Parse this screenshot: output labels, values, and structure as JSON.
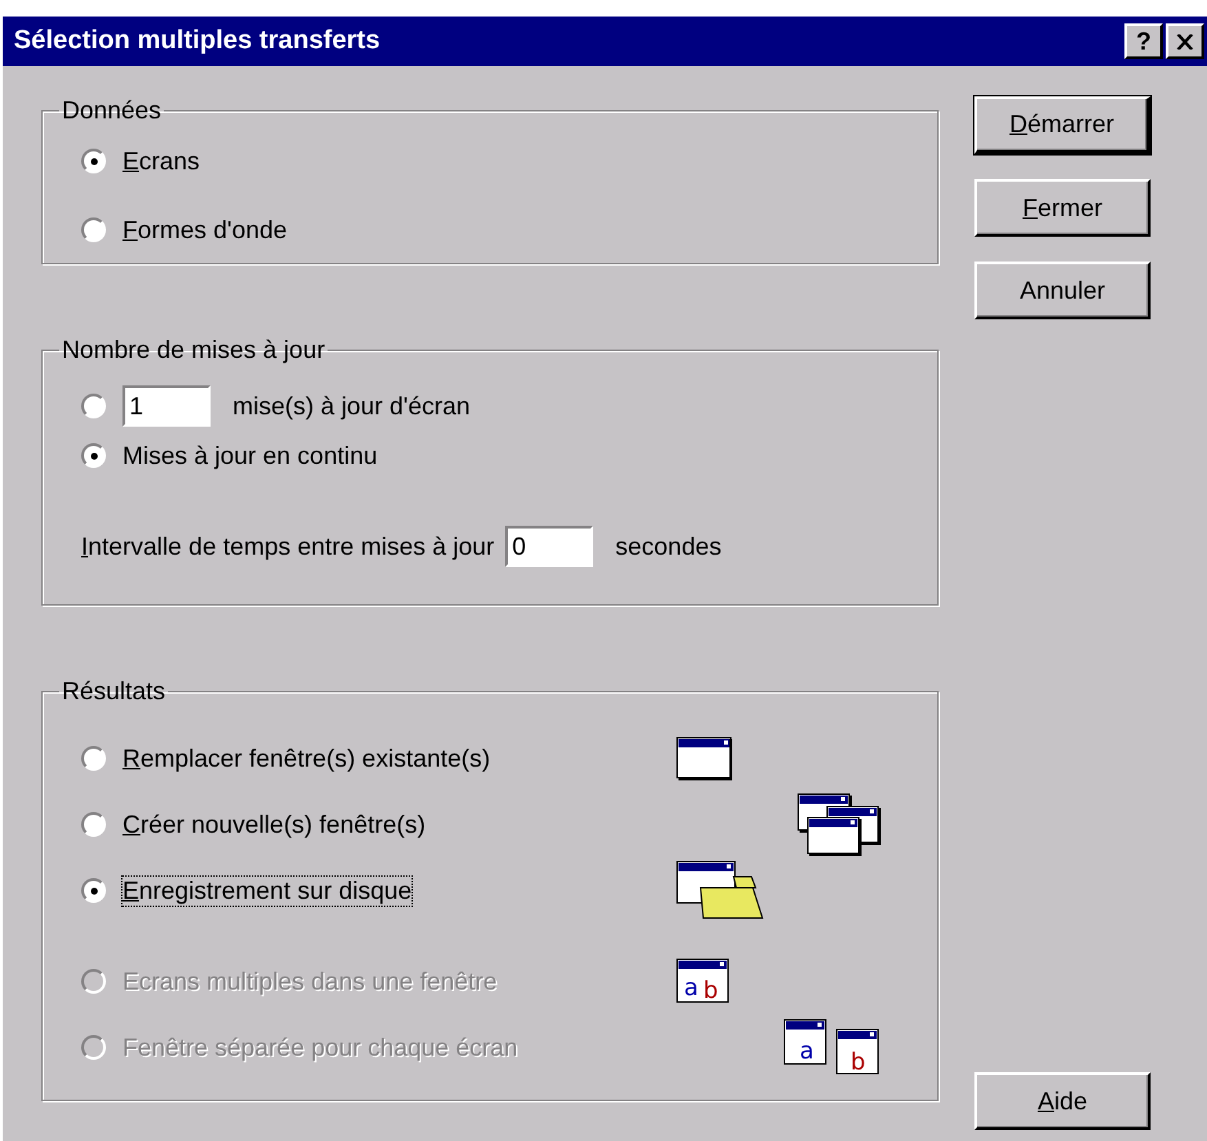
{
  "window": {
    "title": "Sélection multiples transferts",
    "help_button": "?"
  },
  "data_group": {
    "legend": "Données",
    "options": [
      {
        "label": "Ecrans",
        "selected": true,
        "mnemonic": true
      },
      {
        "label": "Formes d'onde",
        "selected": false,
        "mnemonic": true
      }
    ]
  },
  "updates_group": {
    "legend": "Nombre de mises à jour",
    "options": [
      {
        "kind": "count",
        "value": "1",
        "unit": "mise(s) à jour d'écran",
        "selected": false,
        "mnemonic": false
      },
      {
        "kind": "plain",
        "label": "Mises à jour en continu",
        "selected": true,
        "mnemonic": false
      }
    ],
    "interval": {
      "label": "Intervalle de temps entre mises à jour",
      "value": "0",
      "unit": "secondes",
      "mnemonic": true
    }
  },
  "results_group": {
    "legend": "Résultats",
    "options": [
      {
        "label": "Remplacer fenêtre(s) existante(s)",
        "selected": false,
        "disabled": false,
        "focused": false,
        "mnemonic": true,
        "kind": "window"
      },
      {
        "label": "Créer nouvelle(s) fenêtre(s)",
        "selected": false,
        "disabled": false,
        "focused": false,
        "mnemonic": true,
        "kind": "stack"
      },
      {
        "label": "Enregistrement sur disque",
        "selected": true,
        "disabled": false,
        "focused": true,
        "mnemonic": true,
        "kind": "folder"
      },
      {
        "label": "Ecrans multiples dans une fenêtre",
        "selected": false,
        "disabled": true,
        "focused": false,
        "mnemonic": false,
        "kind": "ab",
        "glyphs": [
          "a",
          "b"
        ]
      },
      {
        "label": "Fenêtre séparée pour chaque écran",
        "selected": false,
        "disabled": true,
        "focused": false,
        "mnemonic": false,
        "kind": "pair",
        "glyphs": [
          "a",
          "b"
        ]
      }
    ]
  },
  "buttons": [
    {
      "label": "Démarrer",
      "default": true,
      "mnemonic": true
    },
    {
      "label": "Fermer",
      "default": false,
      "mnemonic": true
    },
    {
      "label": "Annuler",
      "default": false,
      "mnemonic": false
    }
  ],
  "help": {
    "label": "Aide",
    "default": false,
    "mnemonic": true
  }
}
